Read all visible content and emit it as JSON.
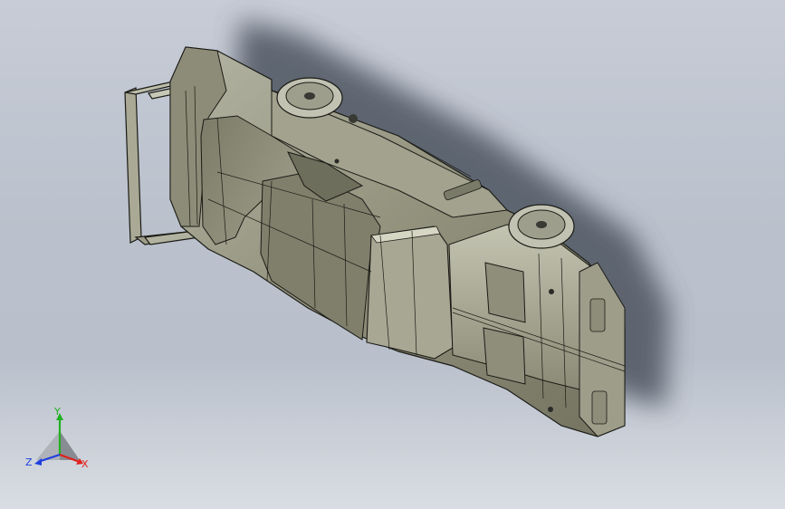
{
  "viewport": {
    "name": "cad-graphics-area",
    "background_top": "#c7ccd6",
    "background_bottom": "#d9dde3"
  },
  "model": {
    "body_color": "#8f8f80",
    "highlight_color": "#b4b4a4",
    "shadow_color": "#5a5f69",
    "edge_color": "#1b1b16",
    "wheel_color": "#3a3a35"
  },
  "triad": {
    "x_label": "X",
    "y_label": "Y",
    "z_label": "Z",
    "x_color": "#e0201c",
    "y_color": "#21b021",
    "z_color": "#1f3fe0"
  }
}
